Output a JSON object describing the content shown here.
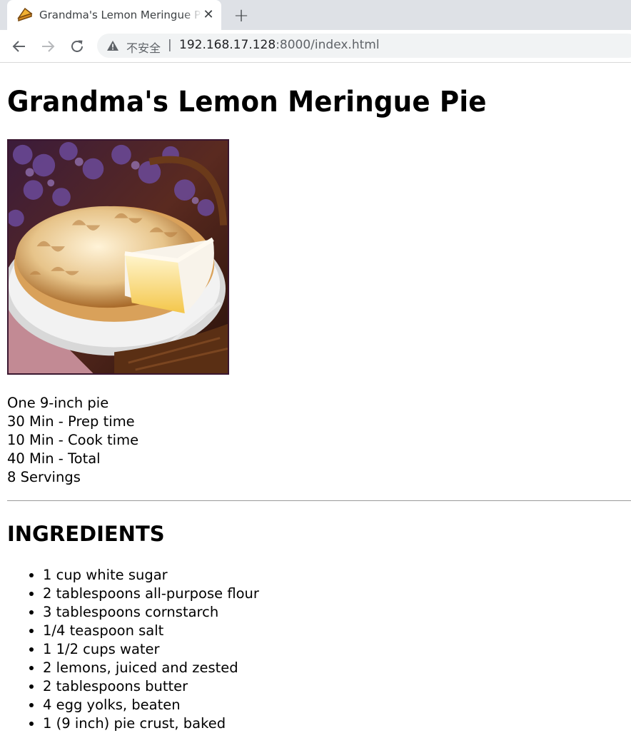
{
  "browser": {
    "tab_title": "Grandma's Lemon Meringue Pie",
    "tab_close_glyph": "✕",
    "new_tab_glyph": "+",
    "insecure_label": "不安全",
    "separator": "|",
    "url_host": "192.168.17.128",
    "url_rest": ":8000/index.html",
    "icons": [
      "pie-favicon-icon",
      "close-icon",
      "plus-icon",
      "back-arrow-icon",
      "forward-arrow-icon",
      "reload-icon",
      "warning-icon"
    ]
  },
  "page": {
    "title": "Grandma's Lemon Meringue Pie",
    "image_alt": "Lemon meringue pie",
    "facts": [
      "One 9-inch pie",
      "30 Min - Prep time",
      "10 Min - Cook time",
      "40 Min - Total",
      "8 Servings"
    ],
    "ingredients_heading": "INGREDIENTS",
    "ingredients": [
      "1 cup white sugar",
      "2 tablespoons all-purpose flour",
      "3 tablespoons cornstarch",
      "1/4 teaspoon salt",
      "1 1/2 cups water",
      "2 lemons, juiced and zested",
      "2 tablespoons butter",
      "4 egg yolks, beaten",
      "1 (9 inch) pie crust, baked"
    ]
  },
  "colors": {
    "tabstrip": "#dee1e6",
    "omnibox": "#f1f3f4",
    "photo_border": "#3a1730"
  }
}
